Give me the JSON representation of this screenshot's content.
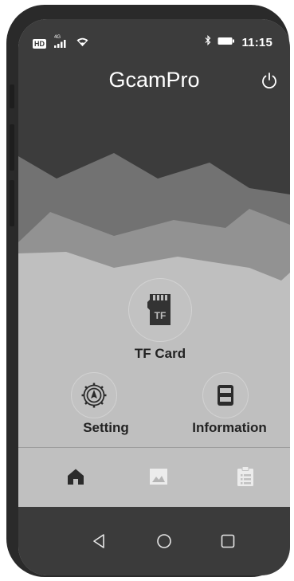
{
  "status_bar": {
    "hd_badge": "HD",
    "network": "4G",
    "time": "11:15",
    "icons": [
      "signal-icon",
      "wifi-icon",
      "bluetooth-icon",
      "battery-icon"
    ]
  },
  "header": {
    "title": "GcamPro",
    "power_icon": "power-icon"
  },
  "menu": {
    "tf_card": {
      "label": "TF Card",
      "icon": "sd-card-icon",
      "icon_text": "TF"
    },
    "setting": {
      "label": "Setting",
      "icon": "gear-icon"
    },
    "information": {
      "label": "Information",
      "icon": "storage-icon"
    }
  },
  "bottom_tabs": [
    {
      "name": "home",
      "icon": "home-icon",
      "active": true
    },
    {
      "name": "gallery",
      "icon": "image-icon",
      "active": false
    },
    {
      "name": "log",
      "icon": "clipboard-icon",
      "active": false
    }
  ],
  "nav_bar": [
    "back-icon",
    "home-circle-icon",
    "recents-icon"
  ],
  "colors": {
    "header_bg": "#3c3c3c",
    "mountain_dark": "#6f6f6f",
    "mountain_mid": "#8f8f8f",
    "content_bg": "#bfbfbf",
    "text": "#222222",
    "nav_bg": "#3b3b3b",
    "tab_active": "#2b2b2b",
    "tab_inactive": "#ececec"
  }
}
